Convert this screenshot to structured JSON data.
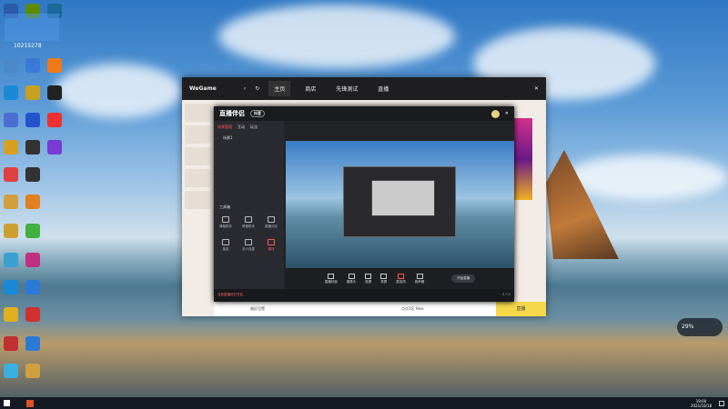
{
  "desktop": {
    "badge_number": "10215278",
    "icons": [
      [
        "#2a5aa8",
        "#5b8c00",
        "#1a6a9a"
      ],
      [
        "#4a8acb",
        "#3a7ad6",
        "#f07a1a"
      ],
      [
        "#1a8ad6",
        "#c8a020",
        "#222"
      ],
      [
        "#4a6fd0",
        "#2255cc",
        "#f03030"
      ],
      [
        "#d8a020",
        "#333",
        "#7a3ad6"
      ],
      [
        "#e04040",
        "#333",
        "#333"
      ],
      [
        "#d0a040",
        "#e08020",
        "#333"
      ],
      [
        "#caa030",
        "#40b040",
        "#333"
      ],
      [
        "#3aa0d0",
        "#c03080",
        "#333"
      ],
      [
        "#1a8ad6",
        "#2a7ad6",
        "#333"
      ],
      [
        "#e0b020",
        "#d03030",
        "#333"
      ],
      [
        "#c03030",
        "#2a7ad6",
        "#333"
      ],
      [
        "#3ab0e0",
        "#d0a040",
        "#333"
      ]
    ]
  },
  "wegame": {
    "logo": "WeGame",
    "tabs": [
      "主页",
      "商店",
      "先锋测试",
      "直播"
    ],
    "footer": [
      "偏好设置",
      "点击1区 New"
    ],
    "yellow_button": "直播"
  },
  "app": {
    "title": "直播伴侣",
    "badge": "抖音",
    "left_tabs": [
      "场景管理",
      "互动",
      "玩法"
    ],
    "scene": "场景1",
    "toolbox": "工具箱",
    "tools": [
      "弹幕助手",
      "房管助手",
      "直播分区",
      "抽奖",
      "多人连麦",
      "素材"
    ],
    "bottom_tools": [
      "直播封面",
      "摄像头",
      "投屏",
      "录屏",
      "麦克风",
      "扬声器"
    ],
    "start_button": "开始直播",
    "status": "当前直播间已开启",
    "notice": "8.7.6"
  },
  "tray": {
    "time": "19:00",
    "date": "2021/10/18"
  },
  "meter": {
    "value": "29%"
  }
}
